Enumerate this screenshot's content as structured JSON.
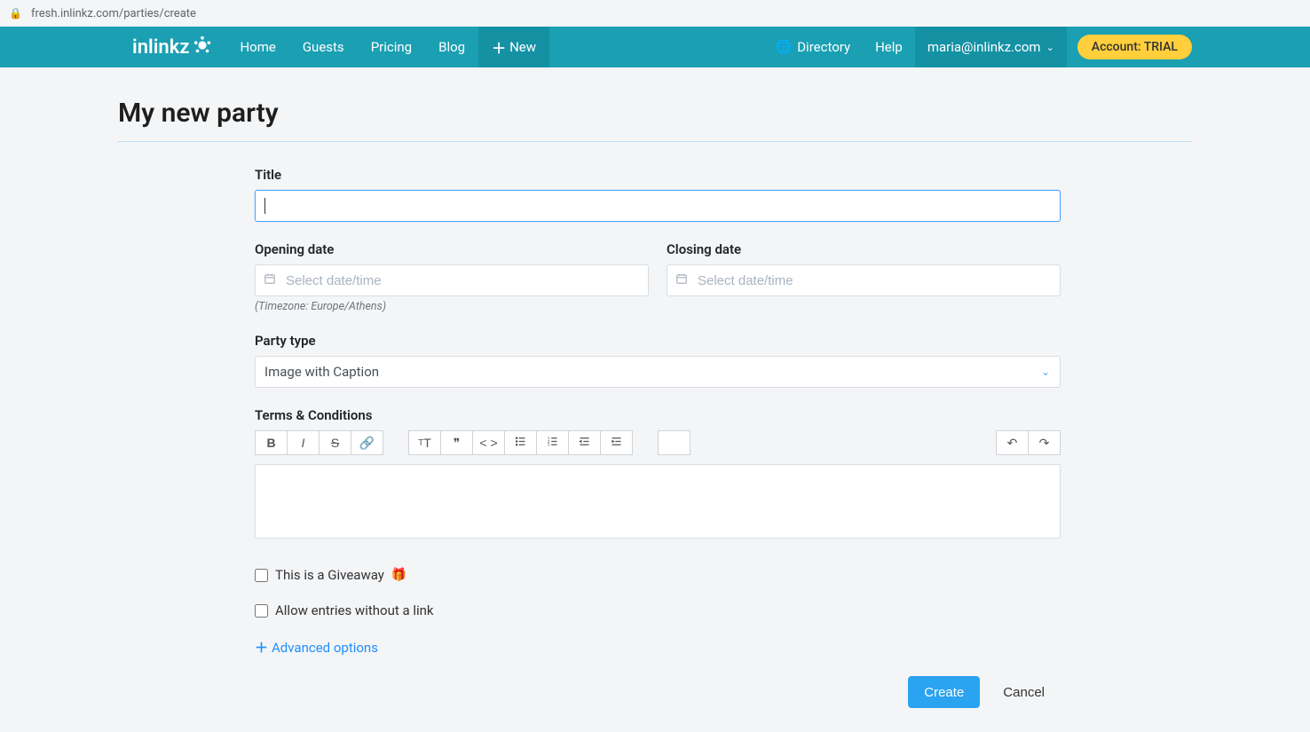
{
  "browser": {
    "url": "fresh.inlinkz.com/parties/create"
  },
  "nav": {
    "logo": "inlinkz",
    "items": [
      "Home",
      "Guests",
      "Pricing",
      "Blog"
    ],
    "newLabel": "New",
    "directory": "Directory",
    "help": "Help",
    "userEmail": "maria@inlinkz.com",
    "accountBadge": "Account: TRIAL"
  },
  "page": {
    "title": "My new party",
    "labels": {
      "title": "Title",
      "opening": "Opening date",
      "closing": "Closing date",
      "partyType": "Party type",
      "terms": "Terms & Conditions"
    },
    "placeholders": {
      "date": "Select date/time"
    },
    "timezoneHint": "(Timezone: Europe/Athens)",
    "partyTypeSelected": "Image with Caption",
    "checkboxes": {
      "giveaway": "This is a Giveaway",
      "allowNoLink": "Allow entries without a link"
    },
    "advanced": "Advanced options",
    "actions": {
      "create": "Create",
      "cancel": "Cancel"
    }
  }
}
